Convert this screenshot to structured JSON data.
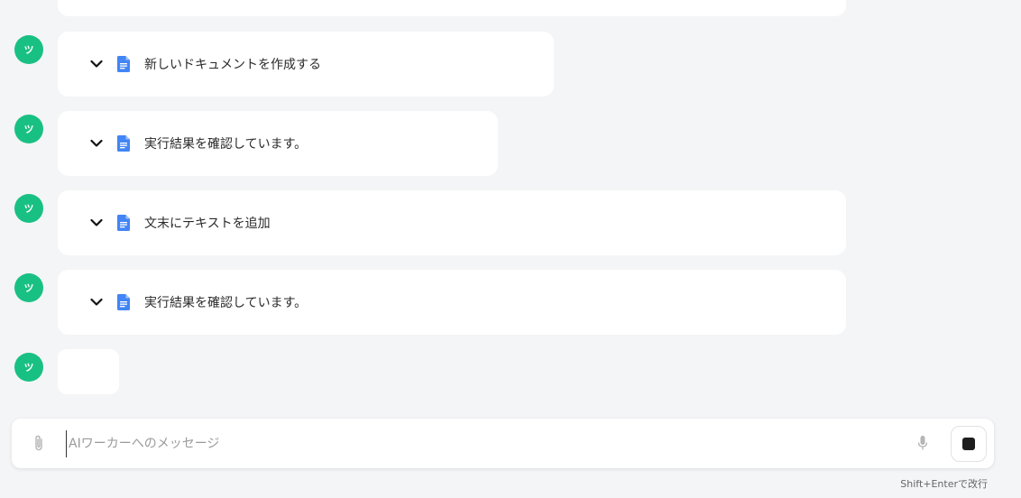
{
  "messages": [
    {
      "avatar": "ツ",
      "label": "新しいドキュメントを作成する"
    },
    {
      "avatar": "ツ",
      "label": "実行結果を確認しています。"
    },
    {
      "avatar": "ツ",
      "label": "文末にテキストを追加"
    },
    {
      "avatar": "ツ",
      "label": "実行結果を確認しています。"
    },
    {
      "avatar": "ツ"
    }
  ],
  "composer": {
    "placeholder": "AIワーカーへのメッセージ",
    "value": "",
    "hint": "Shift+Enterで改行"
  },
  "icons": {
    "chevron": "chevron-down-icon",
    "document": "google-docs-icon",
    "attach": "paperclip-icon",
    "mic": "microphone-icon",
    "stop": "stop-icon"
  },
  "colors": {
    "avatar": "#19c084",
    "doc_icon": "#4285f4",
    "background": "#f4f5f6"
  }
}
